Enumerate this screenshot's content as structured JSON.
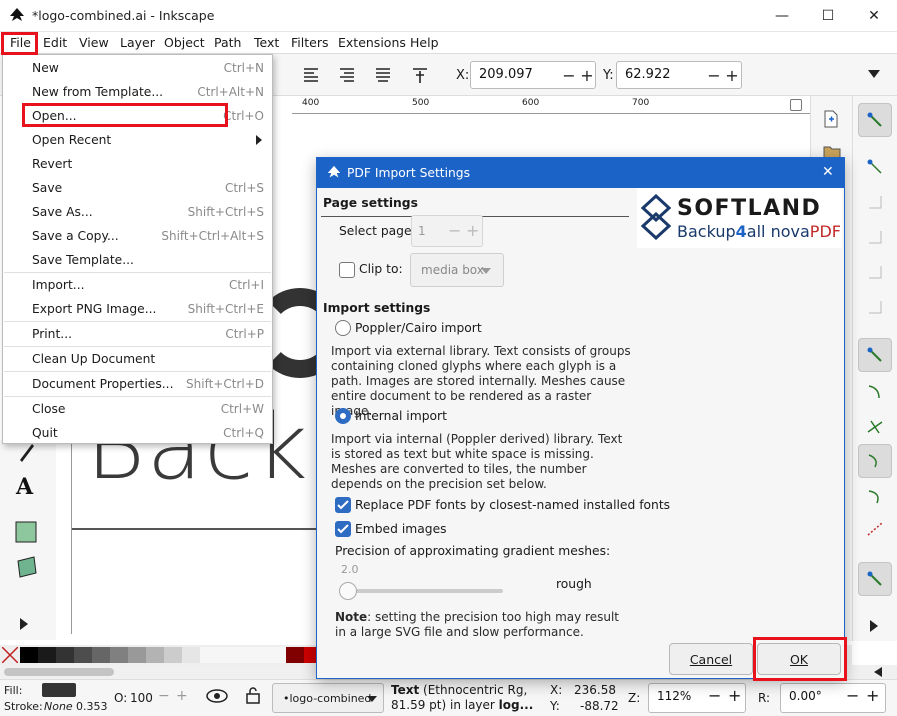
{
  "window": {
    "title": "*logo-combined.ai - Inkscape",
    "minimize": "—",
    "maximize": "☐",
    "close": "✕"
  },
  "menubar": {
    "items": [
      "File",
      "Edit",
      "View",
      "Layer",
      "Object",
      "Path",
      "Text",
      "Filters",
      "Extensions",
      "Help"
    ]
  },
  "toolbar": {
    "x_label": "X:",
    "x_value": "209.097",
    "y_label": "Y:",
    "y_value": "62.922",
    "minus": "−",
    "plus": "+"
  },
  "ruler": {
    "ticks": [
      "400",
      "500",
      "600",
      "700"
    ]
  },
  "canvas": {
    "text": "Backu"
  },
  "file_menu": {
    "items": [
      {
        "label": "New",
        "shortcut": "Ctrl+N"
      },
      {
        "label": "New from Template...",
        "shortcut": "Ctrl+Alt+N"
      },
      {
        "label": "Open...",
        "shortcut": "Ctrl+O"
      },
      {
        "label": "Open Recent",
        "shortcut": ""
      },
      {
        "label": "Revert",
        "shortcut": ""
      },
      {
        "label": "Save",
        "shortcut": "Ctrl+S"
      },
      {
        "label": "Save As...",
        "shortcut": "Shift+Ctrl+S"
      },
      {
        "label": "Save a Copy...",
        "shortcut": "Shift+Ctrl+Alt+S"
      },
      {
        "label": "Save Template...",
        "shortcut": ""
      },
      {
        "label": "Import...",
        "shortcut": "Ctrl+I"
      },
      {
        "label": "Export PNG Image...",
        "shortcut": "Shift+Ctrl+E"
      },
      {
        "label": "Print...",
        "shortcut": "Ctrl+P"
      },
      {
        "label": "Clean Up Document",
        "shortcut": ""
      },
      {
        "label": "Document Properties...",
        "shortcut": "Shift+Ctrl+D"
      },
      {
        "label": "Close",
        "shortcut": "Ctrl+W"
      },
      {
        "label": "Quit",
        "shortcut": "Ctrl+Q"
      }
    ]
  },
  "dialog": {
    "title": "PDF Import Settings",
    "close": "✕",
    "page_settings": "Page settings",
    "select_page_label": "Select page:",
    "select_page_value": "1",
    "clip_to_label": "Clip to:",
    "clip_to_value": "media box",
    "import_settings": "Import settings",
    "poppler_label": "Poppler/Cairo import",
    "poppler_desc": "Import via external library. Text consists of groups containing cloned glyphs where each glyph is a path. Images are stored internally. Meshes cause entire document to be rendered as a raster image.",
    "internal_label": "Internal import",
    "internal_desc": "Import via internal (Poppler derived) library. Text is stored as text but white space is missing. Meshes are converted to tiles, the number depends on the precision set below.",
    "replace_fonts_label": "Replace PDF fonts by closest-named installed fonts",
    "embed_images_label": "Embed images",
    "precision_label": "Precision of approximating gradient meshes:",
    "precision_value": "2.0",
    "precision_desc": "rough",
    "note_bold": "Note",
    "note_text": ": setting the precision too high may result in a large SVG file and slow performance.",
    "cancel": "Cancel",
    "ok": "OK"
  },
  "watermark": {
    "brand": "SOFTLAND",
    "product_a": "Backup",
    "product_num": "4",
    "product_b": "all",
    "product_c": " nova",
    "product_d": "PDF"
  },
  "status": {
    "fill_label": "Fill:",
    "stroke_label": "Stroke:",
    "stroke_value": "None",
    "stroke_width": "0.353",
    "opacity_label": "O:",
    "opacity_value": "100",
    "layer_value": "•logo-combined",
    "msg_bold": "Text",
    "msg_line1": " (Ethnocentric Rg,",
    "msg_line2": "81.59 pt) in layer ",
    "msg_bold2": "log...",
    "x_label": "X:",
    "x_value": "236.58",
    "y_label": "Y:",
    "y_value": "-88.72",
    "zoom_label": "Z:",
    "zoom_value": "112%",
    "rot_label": "R:",
    "rot_value": "0.00°"
  },
  "colors": {
    "accent": "#1c63c7",
    "highlight": "#e8121c",
    "check": "#2e6cc4"
  }
}
